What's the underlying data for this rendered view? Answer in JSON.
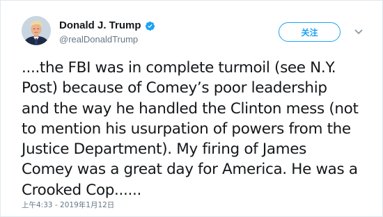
{
  "author": {
    "display_name": "Donald J. Trump",
    "handle": "@realDonaldTrump",
    "verified": true
  },
  "actions": {
    "follow_label": "关注"
  },
  "tweet": {
    "text": "....the FBI was in complete turmoil (see N.Y.\nPost) because of Comey’s poor leadership\nand the way he handled the Clinton mess (not\nto mention his usurpation of powers from the\nJustice Department). My firing of James\nComey was a great day for America. He was a\nCrooked Cop......",
    "timestamp": "上午4:33 - 2019年1月12日"
  },
  "icons": {
    "verified": "verified-badge-icon",
    "menu": "chevron-down-icon"
  },
  "colors": {
    "accent": "#1da1f2",
    "text": "#14171a",
    "muted": "#657786",
    "border": "#e1e8ed"
  }
}
